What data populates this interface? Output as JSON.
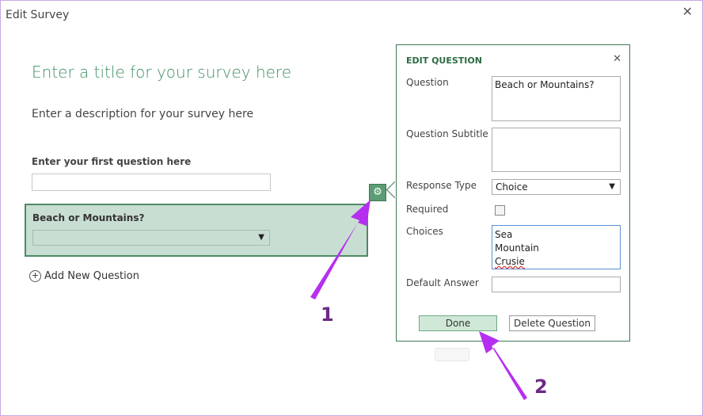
{
  "dialog": {
    "title": "Edit Survey"
  },
  "survey": {
    "title_placeholder": "Enter a title for your survey here",
    "description_placeholder": "Enter a description for your survey here",
    "first_question_placeholder": "Enter your first question here",
    "selected_question": "Beach or Mountains?",
    "add_new_question": "Add New Question"
  },
  "edit_panel": {
    "title": "EDIT QUESTION",
    "question_label": "Question",
    "question_value": "Beach or Mountains?",
    "subtitle_label": "Question Subtitle",
    "subtitle_value": "",
    "response_type_label": "Response Type",
    "response_type_value": "Choice",
    "required_label": "Required",
    "choices_label": "Choices",
    "choices": [
      "Sea",
      "Mountain",
      "Crusie"
    ],
    "default_answer_label": "Default Answer",
    "default_answer_value": "",
    "done_label": "Done",
    "delete_label": "Delete Question"
  },
  "annotations": {
    "one": "1",
    "two": "2"
  },
  "colors": {
    "accent_green": "#3e7a55",
    "highlight_fill": "#c9ded2",
    "arrow_purple": "#b62ff0"
  },
  "icons": {
    "settings": "gear-icon",
    "close": "close-icon",
    "add": "plus-circle-icon",
    "dropdown": "chevron-down-icon"
  }
}
